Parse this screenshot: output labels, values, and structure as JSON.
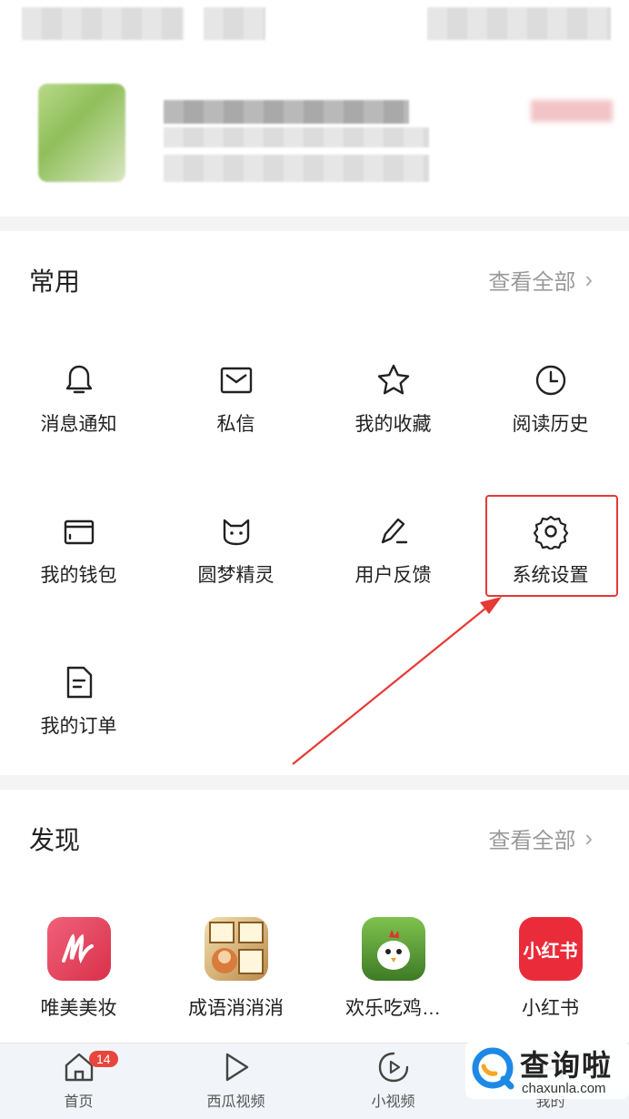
{
  "sections": {
    "common": {
      "title": "常用",
      "see_all": "查看全部"
    },
    "discover": {
      "title": "发现",
      "see_all": "查看全部"
    }
  },
  "tools": [
    {
      "label": "消息通知",
      "icon": "bell-icon"
    },
    {
      "label": "私信",
      "icon": "mail-icon"
    },
    {
      "label": "我的收藏",
      "icon": "star-icon"
    },
    {
      "label": "阅读历史",
      "icon": "clock-icon"
    },
    {
      "label": "我的钱包",
      "icon": "wallet-icon"
    },
    {
      "label": "圆梦精灵",
      "icon": "cat-face-icon"
    },
    {
      "label": "用户反馈",
      "icon": "pen-icon"
    },
    {
      "label": "系统设置",
      "icon": "gear-icon"
    },
    {
      "label": "我的订单",
      "icon": "document-icon"
    }
  ],
  "apps": [
    {
      "label": "唯美美妆",
      "icon": "weimei-app-icon",
      "color": "#e8475b"
    },
    {
      "label": "成语消消消",
      "icon": "idiom-game-icon",
      "color": "#c8a46a"
    },
    {
      "label": "欢乐吃鸡…",
      "icon": "chicken-game-icon",
      "color": "#5e9c3b"
    },
    {
      "label": "小红书",
      "icon": "xiaohongshu-icon",
      "color": "#ea2c3a",
      "icon_text": "小红书"
    }
  ],
  "tabbar": {
    "tabs": [
      {
        "label": "首页",
        "icon": "home-icon",
        "badge": "14"
      },
      {
        "label": "西瓜视频",
        "icon": "play-icon"
      },
      {
        "label": "小视频",
        "icon": "short-video-icon"
      },
      {
        "label": "我的",
        "icon": "profile-icon"
      }
    ]
  },
  "watermark": {
    "title": "查询啦",
    "url": "chaxunla.com"
  },
  "colors": {
    "highlight": "#e53935",
    "badge": "#e8453c"
  }
}
